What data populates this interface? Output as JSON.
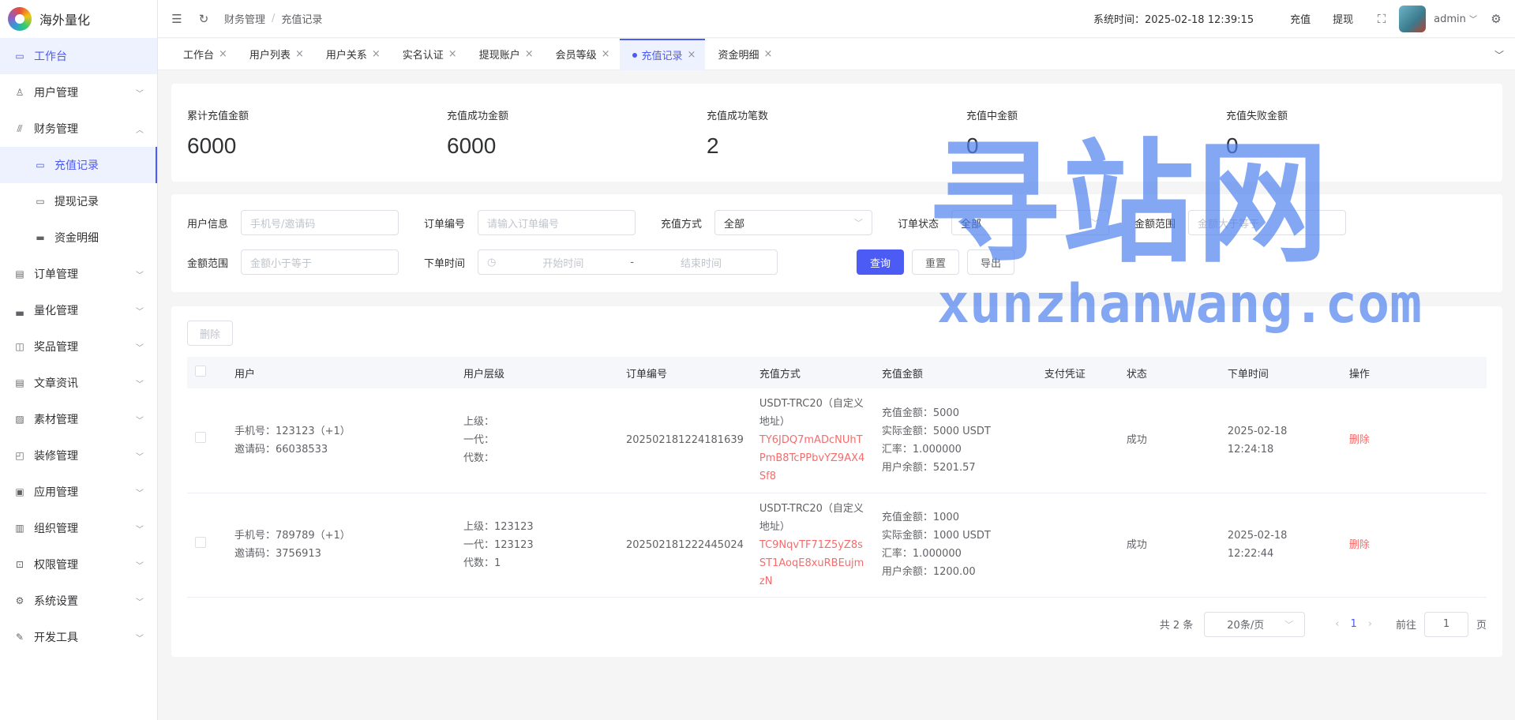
{
  "app": {
    "name": "海外量化"
  },
  "sidebar": {
    "items": [
      {
        "label": "工作台",
        "icon": "monitor-icon"
      },
      {
        "label": "用户管理",
        "icon": "user-icon"
      },
      {
        "label": "财务管理",
        "icon": "chart-icon"
      },
      {
        "label": "充值记录",
        "icon": "folder-icon"
      },
      {
        "label": "提现记录",
        "icon": "folder-icon"
      },
      {
        "label": "资金明细",
        "icon": "wallet-icon"
      },
      {
        "label": "订单管理",
        "icon": "document-icon"
      },
      {
        "label": "量化管理",
        "icon": "robot-icon"
      },
      {
        "label": "奖品管理",
        "icon": "bag-icon"
      },
      {
        "label": "文章资讯",
        "icon": "message-icon"
      },
      {
        "label": "素材管理",
        "icon": "image-icon"
      },
      {
        "label": "装修管理",
        "icon": "brush-icon"
      },
      {
        "label": "应用管理",
        "icon": "app-icon"
      },
      {
        "label": "组织管理",
        "icon": "building-icon"
      },
      {
        "label": "权限管理",
        "icon": "lock-icon"
      },
      {
        "label": "系统设置",
        "icon": "gear-icon"
      },
      {
        "label": "开发工具",
        "icon": "pen-icon"
      }
    ]
  },
  "header": {
    "breadcrumb": [
      "财务管理",
      "充值记录"
    ],
    "system_time": "系统时间：2025-02-18 12:39:15",
    "recharge": "充值",
    "withdraw": "提现",
    "user": "admin"
  },
  "tabs": [
    "工作台",
    "用户列表",
    "用户关系",
    "实名认证",
    "提现账户",
    "会员等级",
    "充值记录",
    "资金明细"
  ],
  "stats": [
    {
      "label": "累计充值金额",
      "value": "6000"
    },
    {
      "label": "充值成功金额",
      "value": "6000"
    },
    {
      "label": "充值成功笔数",
      "value": "2"
    },
    {
      "label": "充值中金额",
      "value": "0"
    },
    {
      "label": "充值失败金额",
      "value": "0"
    }
  ],
  "filter": {
    "user_info_label": "用户信息",
    "user_info_placeholder": "手机号/邀请码",
    "order_no_label": "订单编号",
    "order_no_placeholder": "请输入订单编号",
    "method_label": "充值方式",
    "method_value": "全部",
    "status_label": "订单状态",
    "status_value": "全部",
    "amount_label": "金额范围",
    "amount_min_placeholder": "金额大于等于",
    "amount_max_placeholder": "金额小于等于",
    "time_label": "下单时间",
    "start_placeholder": "开始时间",
    "range_sep": "-",
    "end_placeholder": "结束时间",
    "query": "查询",
    "reset": "重置",
    "export": "导出"
  },
  "table": {
    "delete_btn": "删除",
    "columns": [
      "用户",
      "用户层级",
      "订单编号",
      "充值方式",
      "充值金额",
      "支付凭证",
      "状态",
      "下单时间",
      "操作"
    ],
    "rows": [
      {
        "phone": "手机号：123123（+1）",
        "invite": "邀请码：66038533",
        "level1": "上级：",
        "level2": "一代：",
        "level3": "代数：",
        "order_no": "202502181224181639",
        "method": "USDT-TRC20（自定义地址）",
        "address": "TY6JDQ7mADcNUhTPmB8TcPPbvYZ9AX4Sf8",
        "amount": "充值金额：5000",
        "actual": "实际金额：5000 USDT",
        "rate": "汇率：1.000000",
        "balance": "用户余额：5201.57",
        "status": "成功",
        "time": "2025-02-18 12:24:18",
        "action": "删除"
      },
      {
        "phone": "手机号：789789（+1）",
        "invite": "邀请码：3756913",
        "level1": "上级：123123",
        "level2": "一代：123123",
        "level3": "代数：1",
        "order_no": "202502181222445024",
        "method": "USDT-TRC20（自定义地址）",
        "address": "TC9NqvTF71Z5yZ8sST1AoqE8xuRBEujmzN",
        "amount": "充值金额：1000",
        "actual": "实际金额：1000 USDT",
        "rate": "汇率：1.000000",
        "balance": "用户余额：1200.00",
        "status": "成功",
        "time": "2025-02-18 12:22:44",
        "action": "删除"
      }
    ]
  },
  "pagination": {
    "total": "共 2 条",
    "page_size": "20条/页",
    "current": "1",
    "goto": "前往",
    "goto_value": "1",
    "page_unit": "页"
  },
  "watermark": {
    "cn": "寻站网",
    "en": "xunzhanwang.com"
  },
  "colors": {
    "accent": "#4d5bf5",
    "danger": "#f56c6c"
  }
}
